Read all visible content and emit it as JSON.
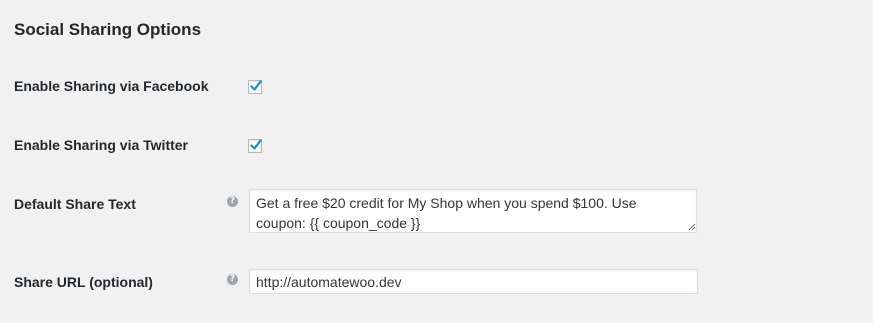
{
  "section": {
    "title": "Social Sharing Options"
  },
  "fields": {
    "facebook": {
      "label": "Enable Sharing via Facebook",
      "checked": true
    },
    "twitter": {
      "label": "Enable Sharing via Twitter",
      "checked": true
    },
    "share_text": {
      "label": "Default Share Text",
      "help_icon": "help-tip-icon",
      "value": "Get a free $20 credit for My Shop when you spend $100. Use coupon: {{ coupon_code }}"
    },
    "share_url": {
      "label": "Share URL (optional)",
      "help_icon": "help-tip-icon",
      "value": "http://automatewoo.dev"
    }
  },
  "colors": {
    "background": "#f1f1f1",
    "text": "#23282d",
    "checkmark": "#1e8cbe",
    "help_icon": "#a0a5aa",
    "input_border": "#dddddd"
  }
}
